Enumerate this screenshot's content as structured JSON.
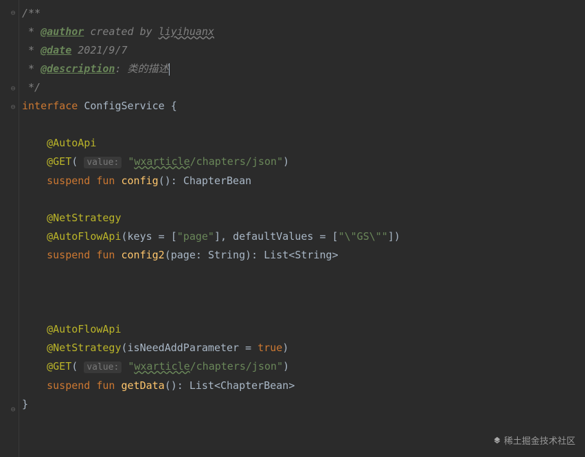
{
  "doc": {
    "open": "/**",
    "authorTag": "@author",
    "authorText": " created by ",
    "authorLink": "liyihuanx",
    "dateTag": "@date",
    "dateValue": " 2021/9/7",
    "descTag": "@description",
    "descSep": ": ",
    "descValue": "类的描述",
    "close": " */",
    "star": " * "
  },
  "kw": {
    "interface": "interface",
    "suspend": "suspend",
    "fun": "fun",
    "true": "true"
  },
  "name": {
    "ConfigService": "ConfigService",
    "config": "config",
    "config2": "config2",
    "getData": "getData",
    "page": "page",
    "keysParam": "keys",
    "defaultValuesParam": "defaultValues",
    "isNeedAddParameter": "isNeedAddParameter"
  },
  "ann": {
    "AutoApi": "@AutoApi",
    "GET": "@GET",
    "NetStrategy": "@NetStrategy",
    "AutoFlowApi": "@AutoFlowApi"
  },
  "hint": {
    "value": "value:"
  },
  "str": {
    "wxarticle": "wxarticle",
    "chaptersJson": "/chapters/json",
    "pageKey": "\"page\"",
    "gsValue": "\"\\\"GS\\\"\""
  },
  "type": {
    "ChapterBean": "ChapterBean",
    "String": "String",
    "List": "List"
  },
  "gutter": {
    "collapse": "⊖",
    "expand": "⊕"
  },
  "watermark": "稀土掘金技术社区"
}
